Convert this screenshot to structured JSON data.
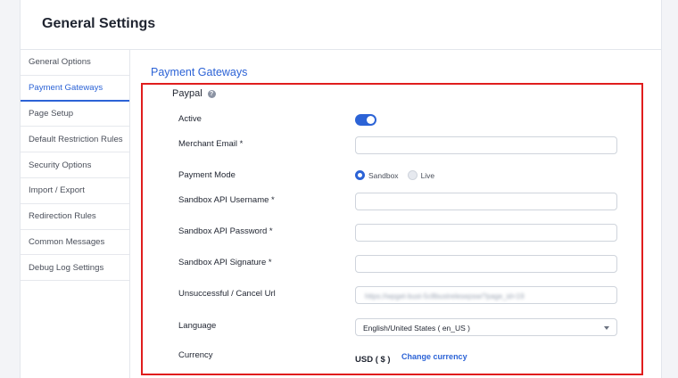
{
  "page": {
    "title": "General Settings"
  },
  "sidebar": {
    "items": [
      {
        "label": "General Options"
      },
      {
        "label": "Payment Gateways",
        "active": true
      },
      {
        "label": "Page Setup"
      },
      {
        "label": "Default Restriction Rules"
      },
      {
        "label": "Security Options"
      },
      {
        "label": "Import / Export"
      },
      {
        "label": "Redirection Rules"
      },
      {
        "label": "Common Messages"
      },
      {
        "label": "Debug Log Settings"
      }
    ]
  },
  "section": {
    "title": "Payment Gateways"
  },
  "paypal": {
    "heading": "Paypal",
    "help_icon": "question-circle-icon",
    "active": {
      "label": "Active",
      "value": true
    },
    "merchant_email": {
      "label": "Merchant Email *",
      "value": ""
    },
    "payment_mode": {
      "label": "Payment Mode",
      "options": [
        {
          "label": "Sandbox",
          "checked": true
        },
        {
          "label": "Live",
          "checked": false
        }
      ]
    },
    "api_username": {
      "label": "Sandbox API Username *",
      "value": ""
    },
    "api_password": {
      "label": "Sandbox API Password *",
      "value": ""
    },
    "api_signature": {
      "label": "Sandbox API Signature *",
      "value": ""
    },
    "cancel_url": {
      "label": "Unsuccessful / Cancel Url",
      "value": "https://wpget-bust-5c8bustrelesepsw/?page_id=19"
    },
    "language": {
      "label": "Language",
      "selected": "English/United States ( en_US )"
    },
    "currency": {
      "label": "Currency",
      "value": "USD ( $ )",
      "change_link": "Change currency"
    }
  },
  "colors": {
    "accent": "#2c63d6",
    "highlight_border": "#e01d1d"
  }
}
